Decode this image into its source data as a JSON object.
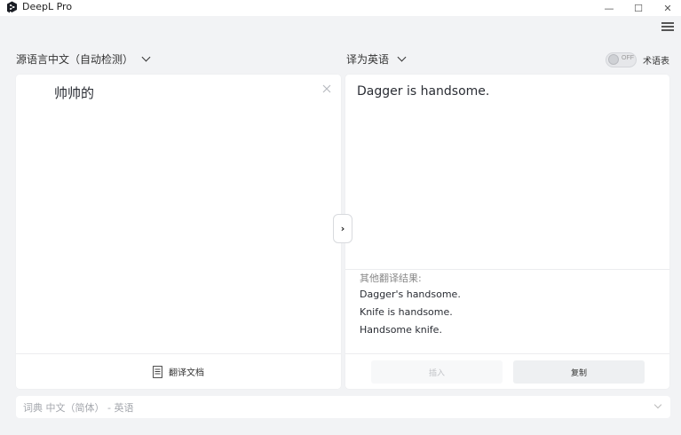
{
  "window": {
    "title": "DeepL Pro",
    "minimize_glyph": "—",
    "maximize_glyph": "☐",
    "close_glyph": "✕"
  },
  "source": {
    "language_label": "源语言中文（自动检测）",
    "text": "帅帅的",
    "translate_document_label": "翻译文档"
  },
  "target": {
    "language_label": "译为英语",
    "text": "Dagger is handsome.",
    "alternatives_heading": "其他翻译结果:",
    "alternatives": [
      "Dagger's handsome.",
      "Knife is handsome.",
      "Handsome knife."
    ],
    "insert_label": "插入",
    "copy_label": "复制"
  },
  "glossary": {
    "toggle_state": "OFF",
    "label": "术语表"
  },
  "swap_glyph": "›",
  "dictionary": {
    "label": "词典 中文（简体） - 英语"
  },
  "icons": {
    "app": "deepl-logo-icon",
    "menu": "hamburger-menu-icon",
    "clear": "close-icon",
    "document": "document-icon",
    "chevron": "chevron-down-icon"
  }
}
